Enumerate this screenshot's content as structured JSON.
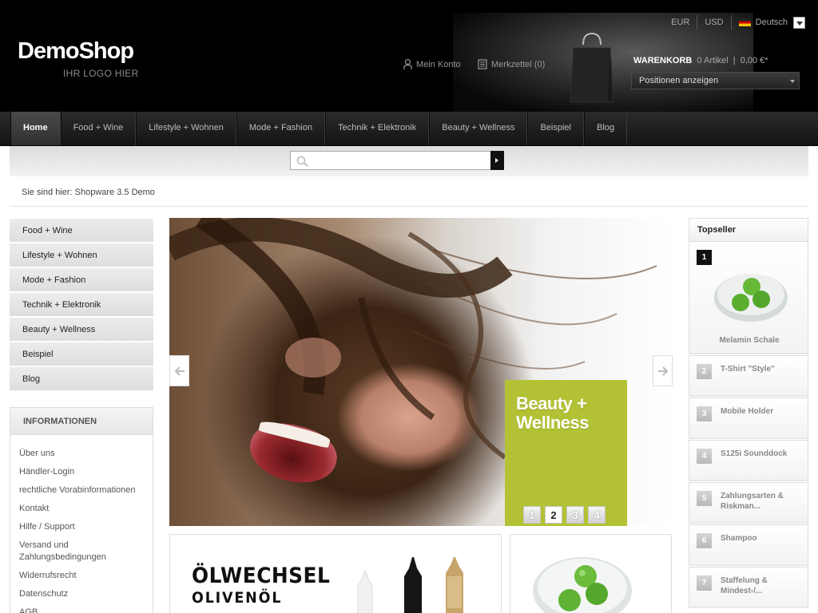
{
  "header": {
    "logo": "DemoShop",
    "logo_sub": "IHR LOGO HIER",
    "currencies": [
      "EUR",
      "USD"
    ],
    "language": "Deutsch",
    "account_link": "Mein Konto",
    "wishlist_link": "Merkzettel (0)",
    "cart": {
      "label": "WARENKORB",
      "items": "0 Artikel",
      "total": "0,00 €*",
      "select_label": "Positionen anzeigen"
    }
  },
  "nav": {
    "items": [
      "Home",
      "Food + Wine",
      "Lifestyle + Wohnen",
      "Mode + Fashion",
      "Technik + Elektronik",
      "Beauty + Wellness",
      "Beispiel",
      "Blog"
    ],
    "active_index": 0
  },
  "search": {
    "placeholder": ""
  },
  "breadcrumb": "Sie sind hier: Shopware 3.5 Demo",
  "sidebar": {
    "categories": [
      "Food + Wine",
      "Lifestyle + Wohnen",
      "Mode + Fashion",
      "Technik + Elektronik",
      "Beauty + Wellness",
      "Beispiel",
      "Blog"
    ],
    "info_title": "INFORMATIONEN",
    "info_links": [
      "Über uns",
      "Händler-Login",
      "rechtliche Vorabinformationen",
      "Kontakt",
      "Hilfe / Support",
      "Versand und Zahlungsbedingungen",
      "Widerrufsrecht",
      "Datenschutz",
      "AGB"
    ]
  },
  "slider": {
    "promo_line1": "Beauty +",
    "promo_line2": "Wellness",
    "pages": [
      "1",
      "2",
      "3",
      "4"
    ],
    "active_page": 1,
    "promo_color": "#b3c234"
  },
  "teasers": {
    "oil_title": "ÖLWECHSEL",
    "oil_sub": "OLIVENÖL"
  },
  "topseller": {
    "title": "Topseller",
    "items": [
      {
        "rank": "1",
        "name": "Melamin Schale"
      },
      {
        "rank": "2",
        "name": "T-Shirt \"Style\""
      },
      {
        "rank": "3",
        "name": "Mobile Holder"
      },
      {
        "rank": "4",
        "name": "S125i Sounddock"
      },
      {
        "rank": "5",
        "name": "Zahlungsarten & Riskman..."
      },
      {
        "rank": "6",
        "name": "Shampoo"
      },
      {
        "rank": "7",
        "name": "Staffelung & Mindest-/..."
      }
    ]
  }
}
